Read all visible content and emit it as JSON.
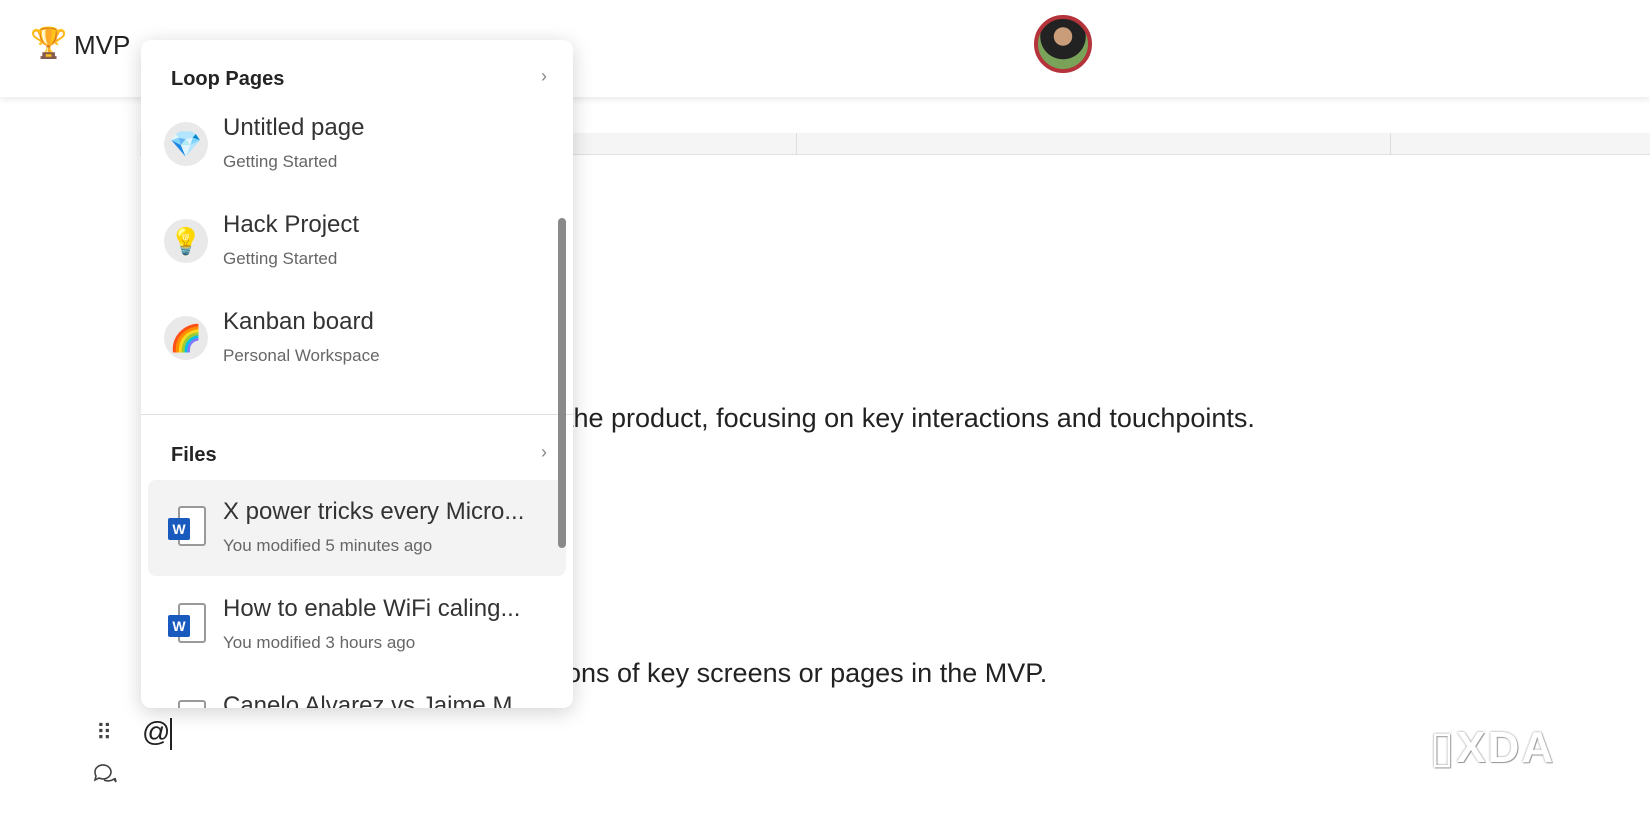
{
  "header": {
    "workspace_icon": "trophy-icon",
    "workspace_title": "MVP",
    "avatar": "user-avatar"
  },
  "body": {
    "line1": "the product, focusing on key interactions and touchpoints.",
    "line2": "ons of key screens or pages in the MVP.",
    "input_text": "@"
  },
  "menu": {
    "loop_section": "Loop Pages",
    "loop_items": [
      {
        "icon": "diamond-icon",
        "glyph": "💎",
        "title": "Untitled page",
        "sub": "Getting Started"
      },
      {
        "icon": "lightbulb-icon",
        "glyph": "💡",
        "title": "Hack Project",
        "sub": "Getting Started"
      },
      {
        "icon": "rainbow-icon",
        "glyph": "🌈",
        "title": "Kanban board",
        "sub": "Personal Workspace"
      }
    ],
    "files_section": "Files",
    "file_items": [
      {
        "title": "X power tricks every Micro...",
        "sub": "You modified 5 minutes ago"
      },
      {
        "title": "How to enable WiFi caling...",
        "sub": "You modified 3 hours ago"
      },
      {
        "title": "Canelo Alvarez vs Jaime M..."
      }
    ],
    "word_badge": "W"
  },
  "watermark": "XDA"
}
